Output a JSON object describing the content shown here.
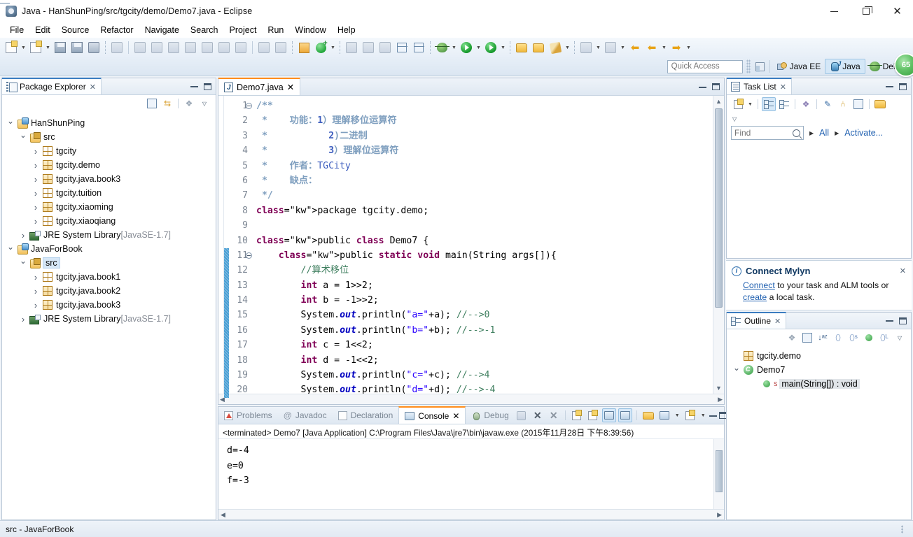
{
  "window": {
    "title": "Java - HanShunPing/src/tgcity/demo/Demo7.java - Eclipse",
    "minimize_label": "Minimize",
    "maximize_label": "Maximize",
    "close_label": "Close"
  },
  "menu": {
    "items": [
      "File",
      "Edit",
      "Source",
      "Refactor",
      "Navigate",
      "Search",
      "Project",
      "Run",
      "Window",
      "Help"
    ]
  },
  "toolbar": {
    "quick_access_placeholder": "Quick Access",
    "perspectives": [
      {
        "label": "Java EE",
        "icon": "java-ee-icon",
        "active": false
      },
      {
        "label": "Java",
        "icon": "java-icon",
        "active": true
      },
      {
        "label": "Debug",
        "icon": "debug-icon",
        "active": false
      }
    ],
    "badge": "65"
  },
  "package_explorer": {
    "title": "Package Explorer",
    "close_label": "✕",
    "tree": [
      {
        "label": "HanShunPing",
        "indent": 0,
        "twist": "open",
        "icon": "java-project-icon",
        "selected": false,
        "suffix": ""
      },
      {
        "label": "src",
        "indent": 1,
        "twist": "open",
        "icon": "source-folder-icon",
        "selected": false,
        "suffix": ""
      },
      {
        "label": "tgcity",
        "indent": 2,
        "twist": "closed",
        "icon": "package-empty-icon",
        "selected": false,
        "suffix": ""
      },
      {
        "label": "tgcity.demo",
        "indent": 2,
        "twist": "closed",
        "icon": "package-icon",
        "selected": false,
        "suffix": ""
      },
      {
        "label": "tgcity.java.book3",
        "indent": 2,
        "twist": "closed",
        "icon": "package-icon",
        "selected": false,
        "suffix": ""
      },
      {
        "label": "tgcity.tuition",
        "indent": 2,
        "twist": "closed",
        "icon": "package-empty-icon",
        "selected": false,
        "suffix": ""
      },
      {
        "label": "tgcity.xiaoming",
        "indent": 2,
        "twist": "closed",
        "icon": "package-icon",
        "selected": false,
        "suffix": ""
      },
      {
        "label": "tgcity.xiaoqiang",
        "indent": 2,
        "twist": "closed",
        "icon": "package-empty-icon",
        "selected": false,
        "suffix": ""
      },
      {
        "label": "JRE System Library",
        "indent": 1,
        "twist": "closed",
        "icon": "library-icon",
        "selected": false,
        "suffix": "[JavaSE-1.7]"
      },
      {
        "label": "JavaForBook",
        "indent": 0,
        "twist": "open",
        "icon": "java-project-icon",
        "selected": false,
        "suffix": ""
      },
      {
        "label": "src",
        "indent": 1,
        "twist": "open",
        "icon": "source-folder-icon",
        "selected": true,
        "suffix": ""
      },
      {
        "label": "tgcity.java.book1",
        "indent": 2,
        "twist": "closed",
        "icon": "package-empty-icon",
        "selected": false,
        "suffix": ""
      },
      {
        "label": "tgcity.java.book2",
        "indent": 2,
        "twist": "closed",
        "icon": "package-icon",
        "selected": false,
        "suffix": ""
      },
      {
        "label": "tgcity.java.book3",
        "indent": 2,
        "twist": "closed",
        "icon": "package-icon",
        "selected": false,
        "suffix": ""
      },
      {
        "label": "JRE System Library",
        "indent": 1,
        "twist": "closed",
        "icon": "library-icon",
        "selected": false,
        "suffix": "[JavaSE-1.7]"
      }
    ]
  },
  "editor": {
    "tab_label": "Demo7.java",
    "close_label": "✕",
    "first_line": 1,
    "lines": [
      {
        "n": 1,
        "fold": true,
        "change": false
      },
      {
        "n": 2,
        "fold": false,
        "change": false
      },
      {
        "n": 3,
        "fold": false,
        "change": false
      },
      {
        "n": 4,
        "fold": false,
        "change": false
      },
      {
        "n": 5,
        "fold": false,
        "change": false
      },
      {
        "n": 6,
        "fold": false,
        "change": false
      },
      {
        "n": 7,
        "fold": false,
        "change": false
      },
      {
        "n": 8,
        "fold": false,
        "change": false
      },
      {
        "n": 9,
        "fold": false,
        "change": false
      },
      {
        "n": 10,
        "fold": false,
        "change": false
      },
      {
        "n": 11,
        "fold": true,
        "change": true
      },
      {
        "n": 12,
        "fold": false,
        "change": true
      },
      {
        "n": 13,
        "fold": false,
        "change": true
      },
      {
        "n": 14,
        "fold": false,
        "change": true
      },
      {
        "n": 15,
        "fold": false,
        "change": true
      },
      {
        "n": 16,
        "fold": false,
        "change": true
      },
      {
        "n": 17,
        "fold": false,
        "change": true
      },
      {
        "n": 18,
        "fold": false,
        "change": true
      },
      {
        "n": 19,
        "fold": false,
        "change": true
      },
      {
        "n": 20,
        "fold": false,
        "change": true
      }
    ],
    "source_text": [
      "/**",
      " *    功能：1）理解移位运算符",
      " *           2)二进制",
      " *           3）理解位运算符",
      " *    作者：TGCity",
      " *    缺点：",
      " */",
      "package tgcity.demo;",
      "",
      "public class Demo7 {",
      "    public static void main(String args[]){",
      "        //算术移位",
      "        int a = 1>>2;",
      "        int b = -1>>2;",
      "        System.out.println(\"a=\"+a); //-->0",
      "        System.out.println(\"b=\"+b); //-->-1",
      "        int c = 1<<2;",
      "        int d = -1<<2;",
      "        System.out.println(\"c=\"+c); //-->4",
      "        System.out.println(\"d=\"+d); //-->-4"
    ]
  },
  "console": {
    "tabs": [
      {
        "label": "Problems",
        "icon": "problems-icon",
        "active": false
      },
      {
        "label": "Javadoc",
        "icon": "javadoc-icon",
        "active": false
      },
      {
        "label": "Declaration",
        "icon": "declaration-icon",
        "active": false
      },
      {
        "label": "Console",
        "icon": "console-icon",
        "active": true
      },
      {
        "label": "Debug",
        "icon": "debug-icon",
        "active": false
      }
    ],
    "close_label": "✕",
    "header": "<terminated> Demo7 [Java Application] C:\\Program Files\\Java\\jre7\\bin\\javaw.exe (2015年11月28日 下午8:39:56)",
    "output": [
      "d=-4",
      "e=0",
      "f=-3"
    ]
  },
  "task_list": {
    "title": "Task List",
    "close_label": "✕",
    "find_placeholder": "Find",
    "filter_all": "All",
    "activate": "Activate..."
  },
  "mylyn": {
    "title": "Connect Mylyn",
    "close_label": "✕",
    "line1_link": "Connect",
    "line1_rest": " to your task and ALM tools or",
    "line2_link": "create",
    "line2_rest": " a local task."
  },
  "outline": {
    "title": "Outline",
    "close_label": "✕",
    "rows": [
      {
        "label": "tgcity.demo",
        "kind": "package",
        "indent": 0,
        "twist": "none",
        "selected": false
      },
      {
        "label": "Demo7",
        "kind": "class",
        "indent": 0,
        "twist": "open",
        "selected": false
      },
      {
        "label": "main(String[]) : void",
        "kind": "method-static",
        "indent": 1,
        "twist": "none",
        "selected": true
      }
    ]
  },
  "status_bar": {
    "text": "src - JavaForBook"
  },
  "colors": {
    "accent_blue": "#3a7cc0",
    "tab_orange": "#ff8c1a",
    "selection_blue": "#d6e7f7",
    "keyword_purple": "#7f0055",
    "string_blue": "#2a00ff",
    "comment_green": "#3f7f5f",
    "javadoc_blue": "#3f5fbf",
    "link_blue": "#2060b0",
    "changebar_blue": "#4a9fd4",
    "badge_green": "#34a03c"
  }
}
